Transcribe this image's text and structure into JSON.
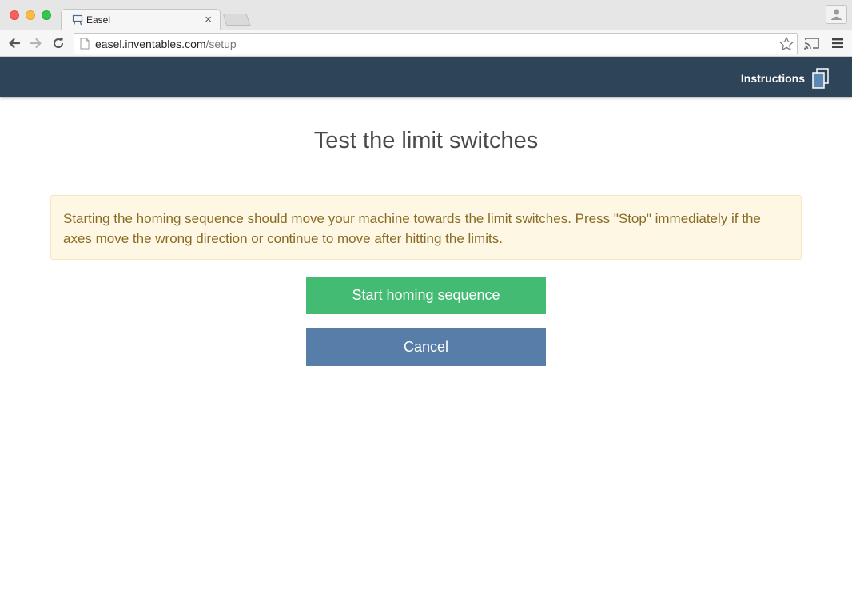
{
  "browser": {
    "tab": {
      "title": "Easel",
      "close_glyph": "×",
      "favicon": "easel-favicon-icon"
    },
    "address": {
      "host": "easel.inventables.com",
      "path": "/setup"
    }
  },
  "app": {
    "header": {
      "instructions_label": "Instructions",
      "instructions_icon": "copy-pages-icon"
    }
  },
  "main": {
    "title": "Test the limit switches",
    "alert_text": "Starting the homing sequence should move your machine towards the limit switches. Press \"Stop\" immediately if the axes move the wrong direction or continue to move after hitting the limits.",
    "start_button_label": "Start homing sequence",
    "cancel_button_label": "Cancel"
  },
  "colors": {
    "header_bg": "#2e4458",
    "start_button": "#43bb73",
    "cancel_button": "#577ea8",
    "alert_bg": "#fdf7e3",
    "alert_text": "#8a6b26",
    "title_text": "#4a4a4a"
  }
}
